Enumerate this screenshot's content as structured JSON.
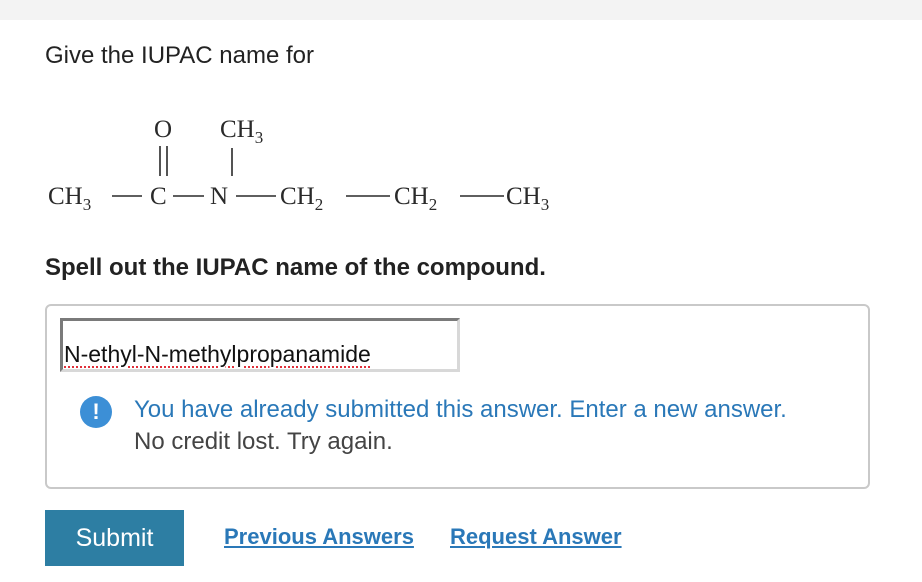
{
  "question": {
    "prompt": "Give the IUPAC name for",
    "instruction": "Spell out the IUPAC name of the compound."
  },
  "structure": {
    "oxygen": "O",
    "carbonyl_carbon": "C",
    "nitrogen": "N",
    "groups": {
      "left_ch3": "CH",
      "n_methyl": "CH",
      "ch2_first": "CH",
      "ch2_second": "CH",
      "terminal_ch3": "CH"
    },
    "subscripts": {
      "left_ch3": "3",
      "n_methyl": "3",
      "ch2_first": "2",
      "ch2_second": "2",
      "terminal_ch3": "3"
    }
  },
  "answer": {
    "value": "N-ethyl-N-methylpropanamide"
  },
  "feedback": {
    "icon": "!",
    "message": "You have already submitted this answer. Enter a new answer.",
    "note": "No credit lost. Try again."
  },
  "actions": {
    "submit_label": "Submit",
    "previous_answers_label": "Previous Answers",
    "request_answer_label": "Request Answer"
  },
  "colors": {
    "accent_button": "#2d7ea3",
    "link": "#2a78b8",
    "info_icon": "#3c8fd6"
  }
}
